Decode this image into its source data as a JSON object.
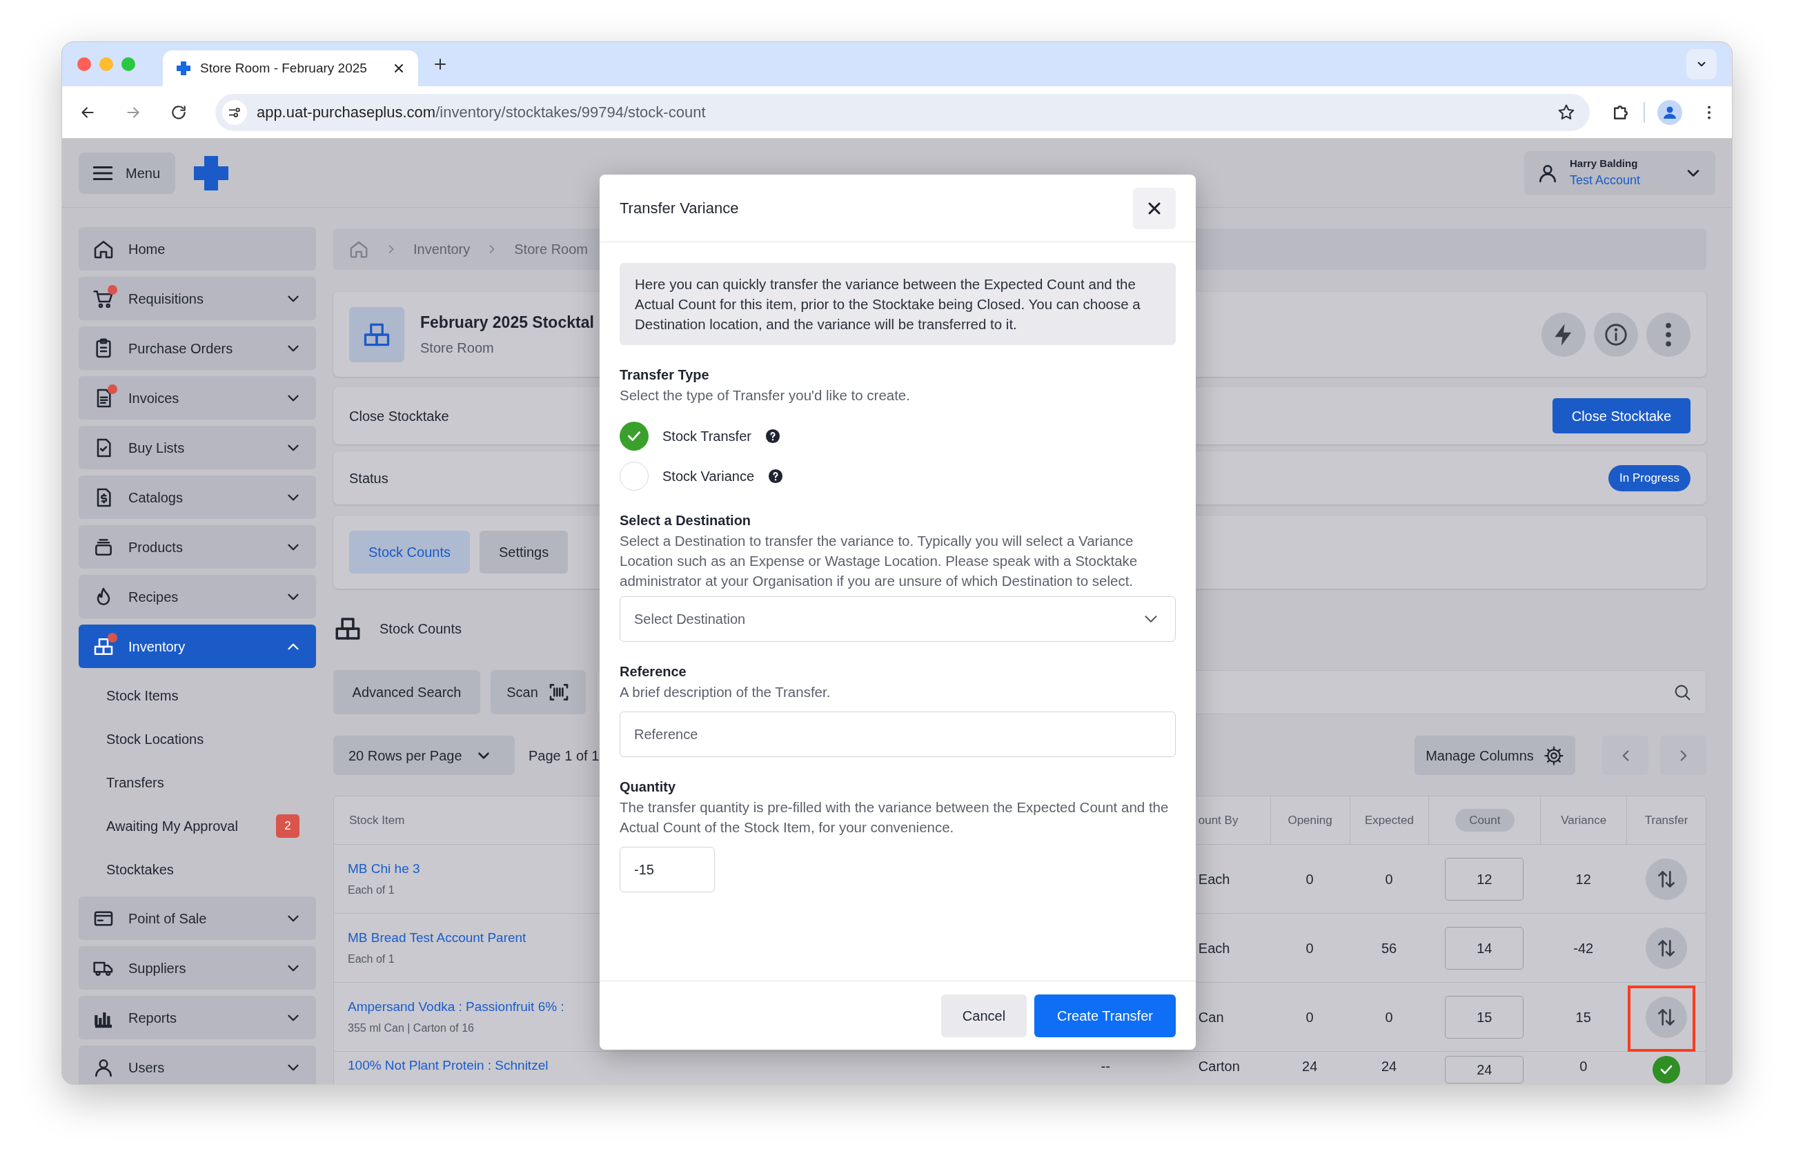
{
  "browser": {
    "tab_title": "Store Room - February 2025",
    "url_host": "app.uat-purchaseplus.com",
    "url_path": "/inventory/stocktakes/99794/stock-count"
  },
  "header": {
    "menu_label": "Menu",
    "user_name": "Harry Balding",
    "account": "Test Account"
  },
  "sidebar": {
    "items": [
      {
        "label": "Home",
        "kind": "link",
        "alert": false,
        "selected": false
      },
      {
        "label": "Requisitions",
        "kind": "group",
        "alert": true,
        "selected": false,
        "expanded": false
      },
      {
        "label": "Purchase Orders",
        "kind": "group",
        "alert": false,
        "selected": false,
        "expanded": false
      },
      {
        "label": "Invoices",
        "kind": "group",
        "alert": true,
        "selected": false,
        "expanded": false
      },
      {
        "label": "Buy Lists",
        "kind": "group",
        "alert": false,
        "selected": false,
        "expanded": false
      },
      {
        "label": "Catalogs",
        "kind": "group",
        "alert": false,
        "selected": false,
        "expanded": false
      },
      {
        "label": "Products",
        "kind": "group",
        "alert": false,
        "selected": false,
        "expanded": false
      },
      {
        "label": "Recipes",
        "kind": "group",
        "alert": false,
        "selected": false,
        "expanded": false
      },
      {
        "label": "Inventory",
        "kind": "group",
        "alert": true,
        "selected": true,
        "expanded": true,
        "children": [
          {
            "label": "Stock Items"
          },
          {
            "label": "Stock Locations"
          },
          {
            "label": "Transfers"
          },
          {
            "label": "Awaiting My Approval",
            "badge": "2"
          },
          {
            "label": "Stocktakes"
          }
        ]
      },
      {
        "label": "Point of Sale",
        "kind": "group",
        "alert": false,
        "selected": false,
        "expanded": false
      },
      {
        "label": "Suppliers",
        "kind": "group",
        "alert": false,
        "selected": false,
        "expanded": false
      },
      {
        "label": "Reports",
        "kind": "group",
        "alert": false,
        "selected": false,
        "expanded": false
      },
      {
        "label": "Users",
        "kind": "group",
        "alert": false,
        "selected": false,
        "expanded": false
      }
    ]
  },
  "breadcrumb": [
    "Inventory",
    "Store Room"
  ],
  "stocktake": {
    "title": "February 2025 Stocktal",
    "location": "Store Room"
  },
  "close_card": {
    "label": "Close Stocktake",
    "button": "Close Stocktake"
  },
  "status_card": {
    "label": "Status",
    "status": "In Progress"
  },
  "tabs": [
    {
      "label": "Stock Counts",
      "selected": true
    },
    {
      "label": "Settings",
      "selected": false
    }
  ],
  "section_title": "Stock Counts",
  "toolbar": {
    "advanced_search": "Advanced Search",
    "scan": "Scan"
  },
  "pagination": {
    "rows_per_page": "20 Rows per Page",
    "page": "Page 1 of 1",
    "manage_columns": "Manage Columns"
  },
  "table": {
    "columns": [
      {
        "label": "Stock Item",
        "sorted": false
      },
      {
        "label": "ount By",
        "sorted": false
      },
      {
        "label": "Opening",
        "sorted": false
      },
      {
        "label": "Expected",
        "sorted": false
      },
      {
        "label": "Count",
        "sorted": true
      },
      {
        "label": "Variance",
        "sorted": false
      },
      {
        "label": "Transfer",
        "sorted": false
      }
    ],
    "rows": [
      {
        "name": "MB Chi he 3",
        "detail": "Each of 1",
        "count_by": "Each",
        "opening": "0",
        "expected": "0",
        "count": "12",
        "variance": "12",
        "transferred": false,
        "highlighted": false
      },
      {
        "name": "MB Bread Test Account Parent",
        "detail": "Each of 1",
        "count_by": "Each",
        "opening": "0",
        "expected": "56",
        "count": "14",
        "variance": "-42",
        "transferred": false,
        "highlighted": false
      },
      {
        "name": "Ampersand Vodka : Passionfruit 6% :",
        "detail": "355 ml Can | Carton of 16",
        "count_by": "Can",
        "opening": "0",
        "expected": "0",
        "count": "15",
        "variance": "15",
        "transferred": false,
        "highlighted": true
      },
      {
        "name": "100% Not Plant Protein : Schnitzel",
        "column_2": "--",
        "count_by": "Carton",
        "opening": "24",
        "expected": "24",
        "count": "24",
        "variance": "0",
        "transferred": true,
        "highlighted": false
      }
    ]
  },
  "modal": {
    "title": "Transfer Variance",
    "intro": "Here you can quickly transfer the variance between the Expected Count and the Actual Count for this item, prior to the Stocktake being Closed. You can choose a Destination location, and the variance will be transferred to it.",
    "transfer_type": {
      "label": "Transfer Type",
      "hint": "Select the type of Transfer you'd like to create.",
      "options": [
        {
          "label": "Stock Transfer",
          "selected": true
        },
        {
          "label": "Stock Variance",
          "selected": false
        }
      ]
    },
    "destination": {
      "label": "Select a Destination",
      "hint": "Select a Destination to transfer the variance to. Typically you will select a Variance Location such as an Expense or Wastage Location. Please speak with a Stocktake administrator at your Organisation if you are unsure of which Destination to select.",
      "placeholder": "Select Destination"
    },
    "reference": {
      "label": "Reference",
      "hint": "A brief description of the Transfer.",
      "placeholder": "Reference"
    },
    "quantity": {
      "label": "Quantity",
      "hint": "The transfer quantity is pre-filled with the variance between the Expected Count and the Actual Count of the Stock Item, for your convenience.",
      "value": "-15"
    },
    "cancel": "Cancel",
    "create": "Create Transfer"
  }
}
